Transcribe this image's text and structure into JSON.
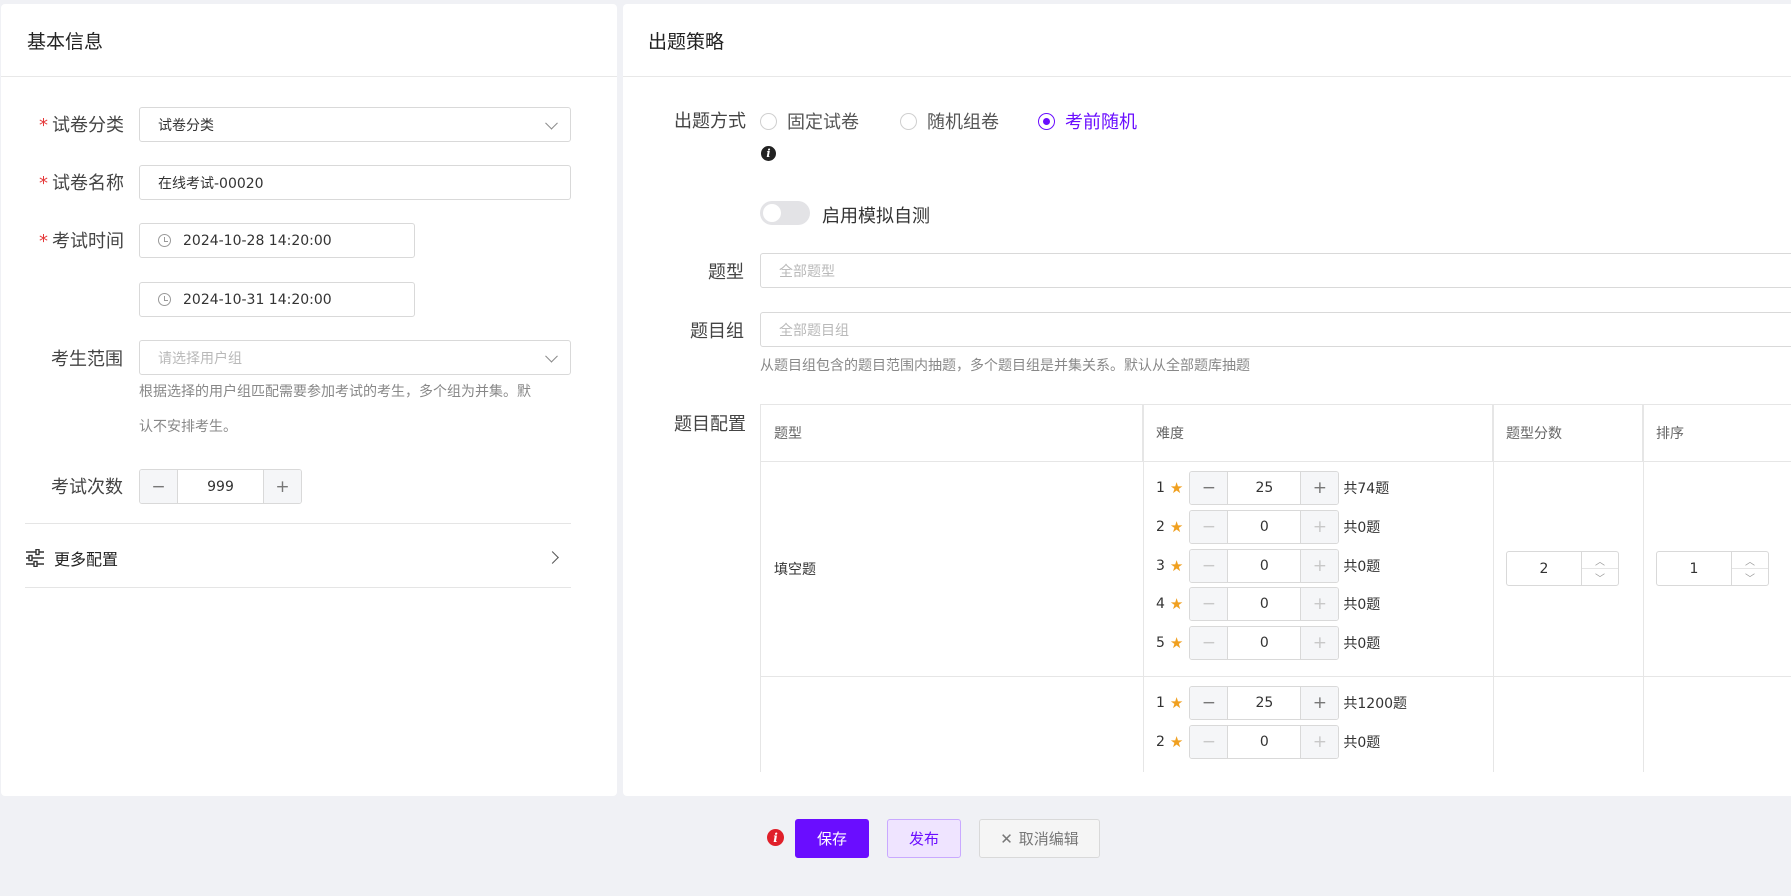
{
  "basic": {
    "title": "基本信息",
    "category": {
      "label": "试卷分类",
      "value": "试卷分类"
    },
    "name": {
      "label": "试卷名称",
      "value": "在线考试-00020"
    },
    "time": {
      "label": "考试时间",
      "start": "2024-10-28 14:20:00",
      "end": "2024-10-31 14:20:00"
    },
    "scope": {
      "label": "考生范围",
      "placeholder": "请选择用户组",
      "help_line1": "根据选择的用户组匹配需要参加考试的考生，多个组为并集。默",
      "help_line2": "认不安排考生。"
    },
    "attempts": {
      "label": "考试次数",
      "value": "999"
    },
    "more": {
      "label": "更多配置"
    }
  },
  "strategy": {
    "title": "出题策略",
    "method": {
      "label": "出题方式",
      "options": [
        "固定试卷",
        "随机组卷",
        "考前随机"
      ],
      "selected": "考前随机"
    },
    "info_glyph": "i",
    "mock": {
      "label": "启用模拟自测",
      "enabled": false
    },
    "qtype": {
      "label": "题型",
      "placeholder": "全部题型"
    },
    "group": {
      "label": "题目组",
      "placeholder": "全部题目组",
      "help": "从题目组包含的题目范围内抽题，多个题目组是并集关系。默认从全部题库抽题"
    },
    "config": {
      "label": "题目配置",
      "headers": [
        "题型",
        "难度",
        "题型分数",
        "排序"
      ],
      "rows": [
        {
          "type": "填空题",
          "levels": [
            {
              "level": "1",
              "count": "25",
              "total": "共74题"
            },
            {
              "level": "2",
              "count": "0",
              "total": "共0题"
            },
            {
              "level": "3",
              "count": "0",
              "total": "共0题"
            },
            {
              "level": "4",
              "count": "0",
              "total": "共0题"
            },
            {
              "level": "5",
              "count": "0",
              "total": "共0题"
            }
          ],
          "score": "2",
          "order": "1"
        },
        {
          "type": "",
          "levels": [
            {
              "level": "1",
              "count": "25",
              "total": "共1200题"
            },
            {
              "level": "2",
              "count": "0",
              "total": "共0题"
            }
          ]
        }
      ]
    }
  },
  "footer": {
    "save": "保存",
    "publish": "发布",
    "cancel": "取消编辑"
  },
  "colors": {
    "accent": "#6a0dff",
    "required": "#e5393a",
    "star": "#f0a020",
    "error": "#e0202a"
  }
}
